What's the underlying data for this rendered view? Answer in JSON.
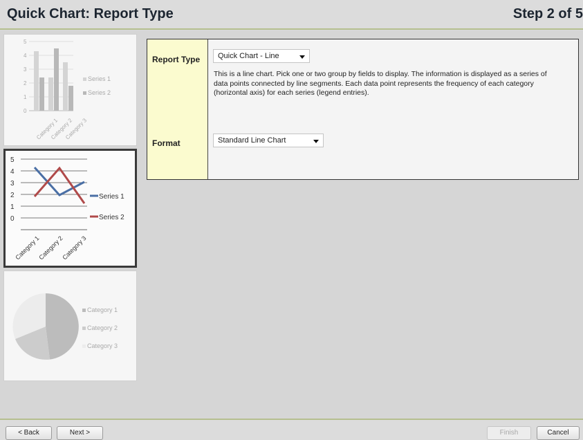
{
  "header": {
    "title": "Quick Chart: Report Type",
    "step": "Step 2 of 5"
  },
  "thumbnails": {
    "bar": {
      "y_ticks": [
        "5",
        "4",
        "3",
        "2",
        "1",
        "0"
      ],
      "categories": [
        "Category 1",
        "Category 2",
        "Category 3"
      ],
      "legend": [
        "Series 1",
        "Series 2"
      ]
    },
    "line": {
      "y_ticks": [
        "5",
        "4",
        "3",
        "2",
        "1",
        "0"
      ],
      "categories": [
        "Category 1",
        "Category 2",
        "Category 3"
      ],
      "legend": [
        "Series 1",
        "Series 2"
      ],
      "series_colors": [
        "#4a6fa5",
        "#b04a4a"
      ]
    },
    "pie": {
      "legend": [
        "Category 1",
        "Category 2",
        "Category 3"
      ]
    }
  },
  "form": {
    "report_type_label": "Report Type",
    "report_type_value": "Quick Chart - Line",
    "description": "This is a line chart. Pick one or two group by fields to display. The information is displayed as a series of data points connected by line segments. Each data point represents the frequency of each category (horizontal axis) for each series (legend entries).",
    "format_label": "Format",
    "format_value": "Standard Line Chart"
  },
  "footer": {
    "back": "< Back",
    "next": "Next >",
    "finish": "Finish",
    "cancel": "Cancel"
  },
  "icons": {
    "dropdown": "chevron-down-icon"
  }
}
